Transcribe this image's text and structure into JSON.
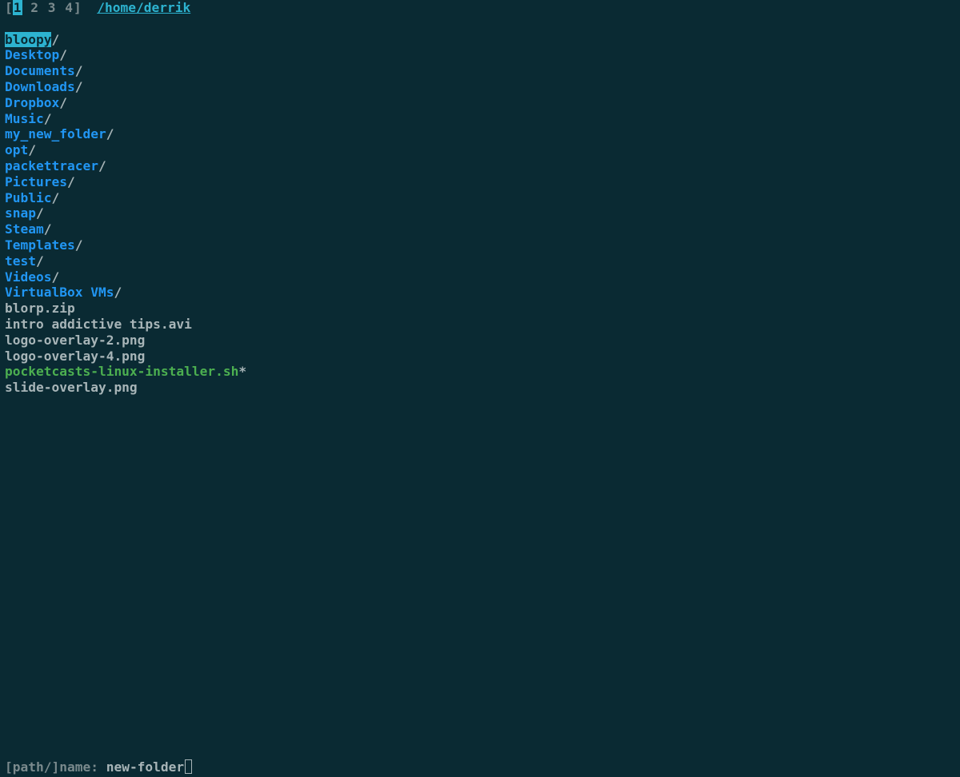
{
  "tabs": {
    "bracket_open": "[",
    "bracket_close": "]",
    "active": 0,
    "labels": [
      "1",
      "2",
      "3",
      "4"
    ]
  },
  "cwd": "/home/derrik",
  "selected_index": 0,
  "entries": [
    {
      "name": "bloopy",
      "type": "dir",
      "suffix": "/"
    },
    {
      "name": "Desktop",
      "type": "dir",
      "suffix": "/"
    },
    {
      "name": "Documents",
      "type": "dir",
      "suffix": "/"
    },
    {
      "name": "Downloads",
      "type": "dir",
      "suffix": "/"
    },
    {
      "name": "Dropbox",
      "type": "dir",
      "suffix": "/"
    },
    {
      "name": "Music",
      "type": "dir",
      "suffix": "/"
    },
    {
      "name": "my_new_folder",
      "type": "dir",
      "suffix": "/"
    },
    {
      "name": "opt",
      "type": "dir",
      "suffix": "/"
    },
    {
      "name": "packettracer",
      "type": "dir",
      "suffix": "/"
    },
    {
      "name": "Pictures",
      "type": "dir",
      "suffix": "/"
    },
    {
      "name": "Public",
      "type": "dir",
      "suffix": "/"
    },
    {
      "name": "snap",
      "type": "dir",
      "suffix": "/"
    },
    {
      "name": "Steam",
      "type": "dir",
      "suffix": "/"
    },
    {
      "name": "Templates",
      "type": "dir",
      "suffix": "/"
    },
    {
      "name": "test",
      "type": "dir",
      "suffix": "/"
    },
    {
      "name": "Videos",
      "type": "dir",
      "suffix": "/"
    },
    {
      "name": "VirtualBox VMs",
      "type": "dir",
      "suffix": "/"
    },
    {
      "name": "blorp.zip",
      "type": "file",
      "suffix": ""
    },
    {
      "name": "intro addictive tips.avi",
      "type": "file",
      "suffix": ""
    },
    {
      "name": "logo-overlay-2.png",
      "type": "file",
      "suffix": ""
    },
    {
      "name": "logo-overlay-4.png",
      "type": "file",
      "suffix": ""
    },
    {
      "name": "pocketcasts-linux-installer.sh",
      "type": "exec",
      "suffix": "*"
    },
    {
      "name": "slide-overlay.png",
      "type": "file",
      "suffix": ""
    }
  ],
  "prompt": {
    "label": "[path/]name: ",
    "value": "new-folder"
  }
}
